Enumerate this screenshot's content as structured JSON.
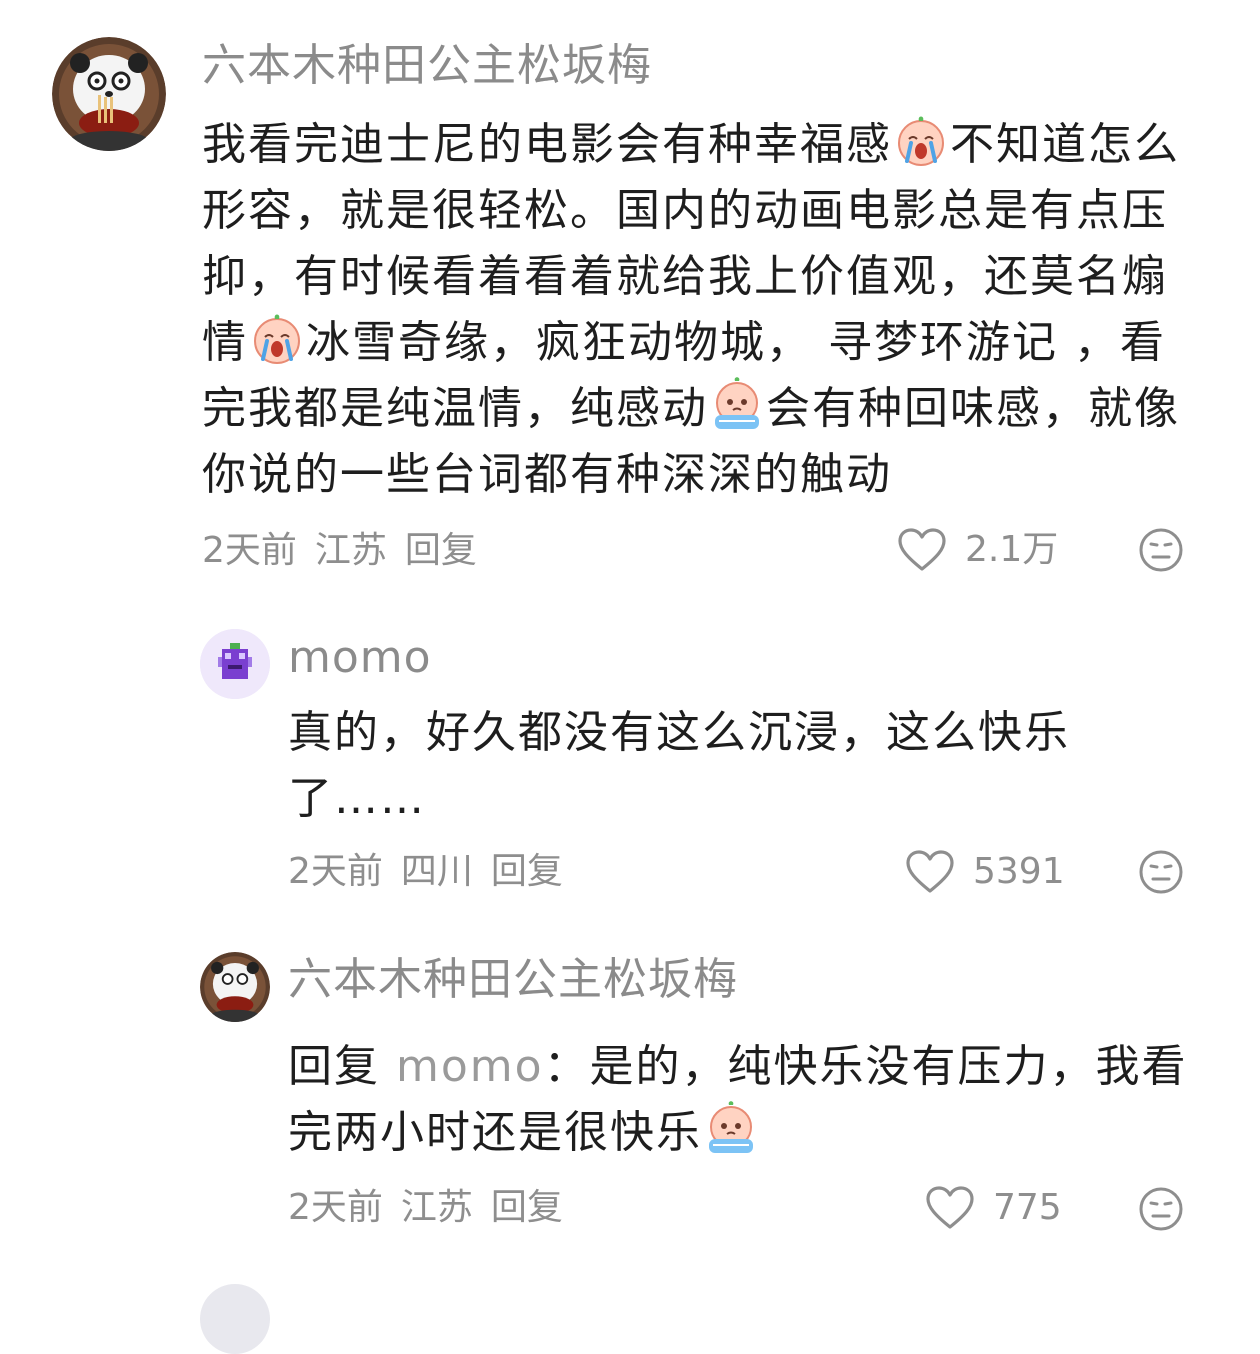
{
  "comments": [
    {
      "username": "六本木种田公主松坂梅",
      "segments": [
        {
          "t": "我看完迪士尼的电影会有种幸福感"
        },
        {
          "e": "crying-baby-emoji"
        },
        {
          "t": "不知道怎么形容，就是很轻松。国内的动画电影总是有点压抑，有时候看着看着就给我上价值观，还莫名煽情"
        },
        {
          "e": "crying-baby-emoji"
        },
        {
          "t": "冰雪奇缘，疯狂动物城， 寻梦环游记 ，看完我都是纯温情，纯感动"
        },
        {
          "e": "teary-baby-emoji"
        },
        {
          "t": "会有种回味感，就像你说的一些台词都有种深深的触动"
        }
      ],
      "time": "2天前",
      "location": "江苏",
      "reply_label": "回复",
      "likes": "2.1万"
    },
    {
      "username": "momo",
      "segments": [
        {
          "t": "真的，好久都没有这么沉浸，这么快乐了……"
        }
      ],
      "time": "2天前",
      "location": "四川",
      "reply_label": "回复",
      "likes": "5391"
    },
    {
      "username": "六本木种田公主松坂梅",
      "segments": [
        {
          "t": "回复 "
        },
        {
          "m": "momo"
        },
        {
          "t": "：是的，纯快乐没有压力，我看完两小时还是很快乐"
        },
        {
          "e": "teary-baby-emoji"
        }
      ],
      "time": "2天前",
      "location": "江苏",
      "reply_label": "回复",
      "likes": "775"
    }
  ],
  "colors": {
    "text": "#1e1e1e",
    "meta": "#8e8e8e",
    "username": "#8b8b8b",
    "momo_avatar": "#7a3fd0"
  }
}
